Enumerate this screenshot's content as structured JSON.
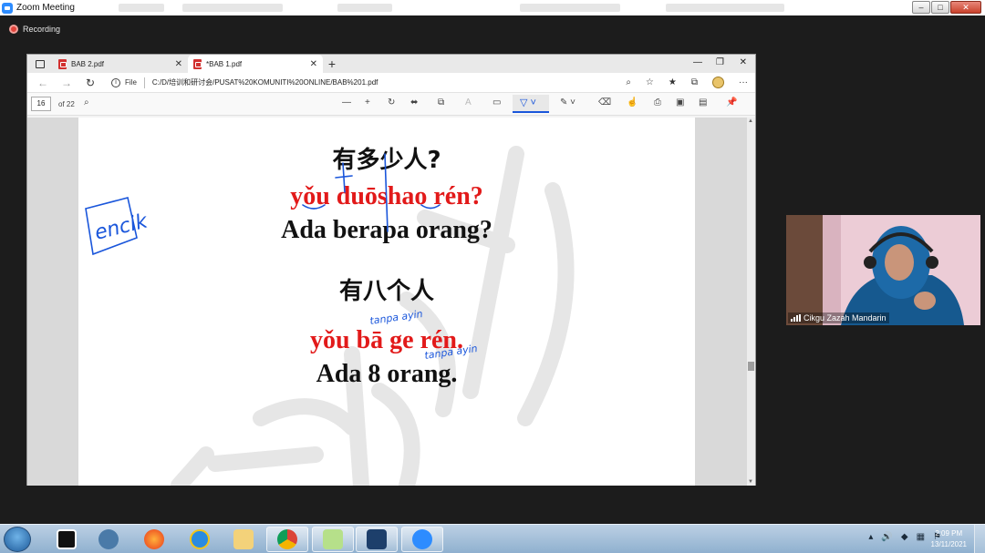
{
  "zoom": {
    "window_title": "Zoom Meeting",
    "recording_label": "Recording",
    "minimize": "–",
    "maximize": "□",
    "close": "✕"
  },
  "browser": {
    "tabs": [
      {
        "label": "BAB 2.pdf",
        "active": false
      },
      {
        "label": "*BAB 1.pdf",
        "active": true
      }
    ],
    "new_tab": "+",
    "file_label": "File",
    "url": "C:/D/培训和研讨会/PUSAT%20KOMUNITI%20ONLINE/BAB%201.pdf"
  },
  "pdf_toolbar": {
    "page_number": "16",
    "page_count": "of 22"
  },
  "pdf_content": {
    "q_hanzi": "有多少人?",
    "q_pinyin": "yǒu duōshao rén?",
    "q_malay": "Ada berapa orang?",
    "a_hanzi": "有八个人",
    "a_pinyin": "yǒu bā ge rén.",
    "a_malay": "Ada 8 orang."
  },
  "annotations": {
    "encik": "encik",
    "note1": "tanpa ayin",
    "note2": "tanpa ayin"
  },
  "webcam": {
    "participant_name": "Cikgu Zazah Mandarin"
  },
  "taskbar": {
    "time": "2:09 PM",
    "date": "13/11/2021"
  },
  "colors": {
    "pinyin_red": "#e21a1a",
    "annotation_blue": "#1a56db",
    "zoom_blue": "#2d8cff"
  }
}
